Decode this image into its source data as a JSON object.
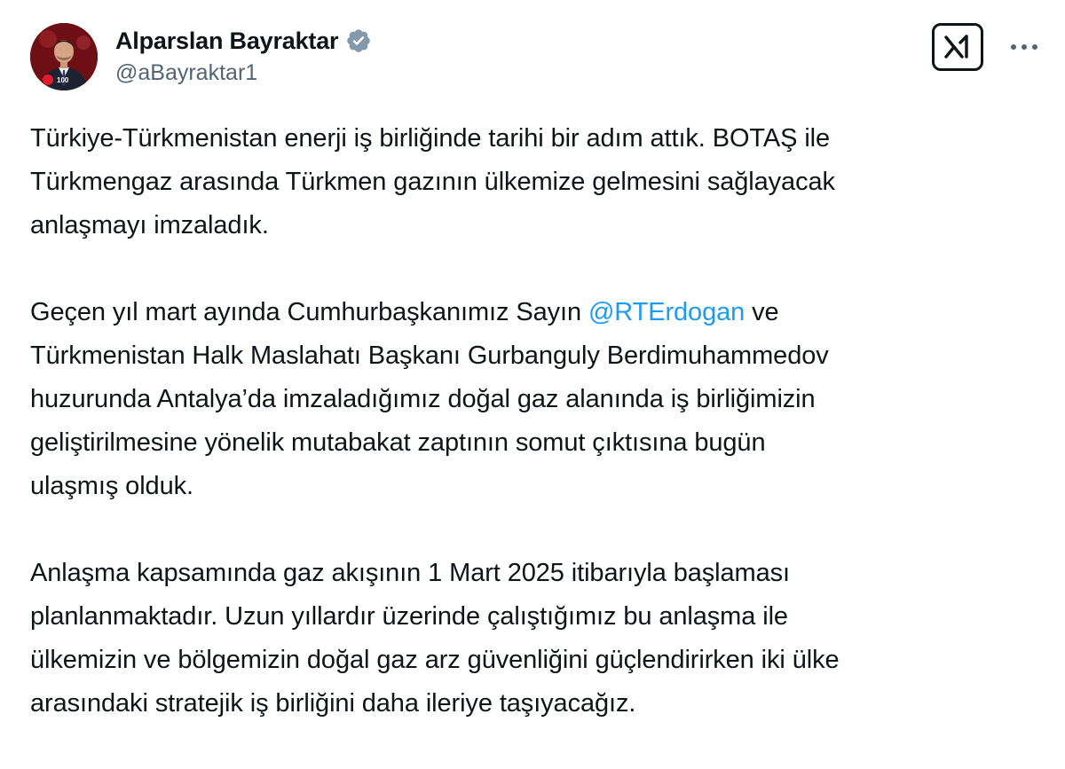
{
  "author": {
    "display_name": "Alparslan Bayraktar",
    "handle": "@aBayraktar1",
    "verified_badge_color": "#829aab",
    "avatar_badge_text": "100"
  },
  "actions": {
    "grok_icon": "grok-logo-icon",
    "more_icon": "more-horizontal-icon"
  },
  "tweet": {
    "paragraph_1": {
      "line_1": "Türkiye-Türkmenistan enerji iş birliğinde tarihi bir adım attık. BOTAŞ ile",
      "line_2": "Türkmengaz arasında Türkmen gazının ülkemize gelmesini sağlayacak",
      "line_3": "anlaşmayı imzaladık."
    },
    "paragraph_2": {
      "line_1_before": "Geçen yıl mart ayında Cumhurbaşkanımız Sayın ",
      "mention": "@RTErdogan",
      "line_1_after": " ve",
      "line_2": "Türkmenistan Halk Maslahatı Başkanı Gurbanguly Berdimuhammedov",
      "line_3": "huzurunda Antalya’da imzaladığımız doğal gaz alanında iş birliğimizin",
      "line_4": "geliştirilmesine yönelik mutabakat zaptının somut çıktısına bugün",
      "line_5": "ulaşmış olduk."
    },
    "paragraph_3": {
      "line_1": "Anlaşma kapsamında gaz akışının 1 Mart 2025 itibarıyla başlaması",
      "line_2": "planlanmaktadır. Uzun yıllardır üzerinde çalıştığımız bu anlaşma ile",
      "line_3": "ülkemizin ve bölgemizin doğal gaz arz güvenliğini güçlendirirken iki ülke",
      "line_4": "arasındaki stratejik iş birliğini daha ileriye taşıyacağız."
    }
  },
  "colors": {
    "text_primary": "#0f1419",
    "text_secondary": "#536471",
    "link": "#1d9bf0",
    "background": "#ffffff"
  }
}
